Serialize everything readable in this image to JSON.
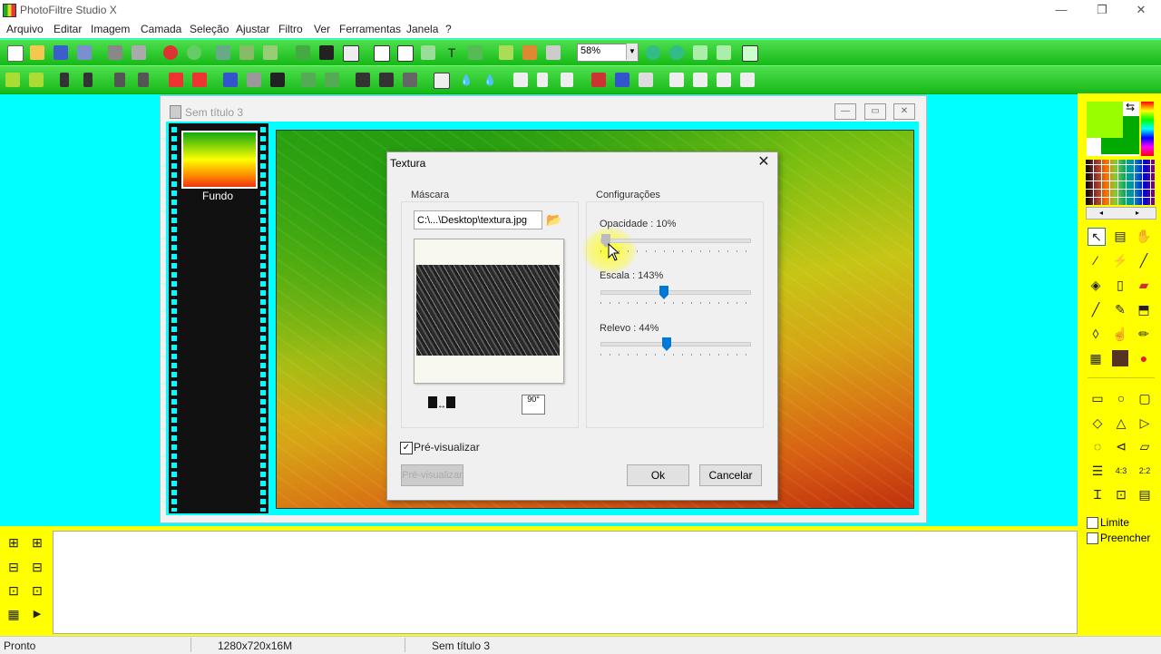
{
  "app": {
    "title": "PhotoFiltre Studio X"
  },
  "window_controls": {
    "minimize": "—",
    "maximize": "❐",
    "close": "✕"
  },
  "menu": [
    "Arquivo",
    "Editar",
    "Imagem",
    "Camada",
    "Seleção",
    "Ajustar",
    "Filtro",
    "Ver",
    "Ferramentas",
    "Janela",
    "?"
  ],
  "toolbar": {
    "zoom": "58%"
  },
  "document": {
    "title": "Sem título 3",
    "layer_name": "Fundo",
    "controls": {
      "minimize": "—",
      "maximize": "▭",
      "close": "✕"
    }
  },
  "dialog": {
    "title": "Textura",
    "close": "✕",
    "mask": {
      "label": "Máscara",
      "path": "C:\\...\\Desktop\\textura.jpg"
    },
    "settings": {
      "label": "Configurações",
      "opacity": {
        "label": "Opacidade : 10%",
        "value": 10
      },
      "scale": {
        "label": "Escala : 143%",
        "value": 143
      },
      "relief": {
        "label": "Relevo : 44%",
        "value": 44
      }
    },
    "preview_checkbox": {
      "label": "Pré-visualizar",
      "checked": true
    },
    "preview_button": "Pré-visualizar",
    "ok": "Ok",
    "cancel": "Cancelar",
    "rotate_label": "90°"
  },
  "right_panel": {
    "limit_label": "Limite",
    "fill_label": "Preencher",
    "fg_color": "#99ff00",
    "bg_color": "#00aa00"
  },
  "status": {
    "left": "Pronto",
    "size": "1280x720x16M",
    "doc": "Sem título 3"
  },
  "colors": {
    "toolbar_green": "#18b818",
    "workspace": "#00ffff",
    "panel": "#ffff00",
    "accent": "#0078d7"
  }
}
